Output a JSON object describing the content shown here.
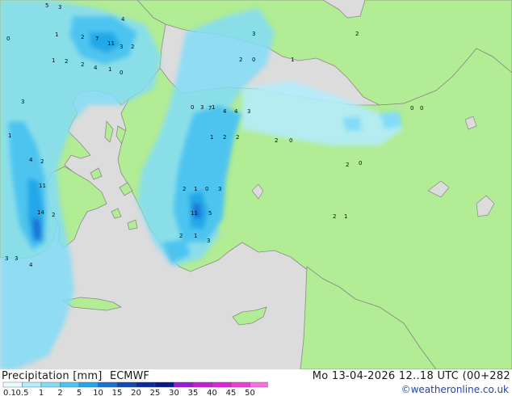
{
  "footer": {
    "title": "Precipitation [mm]",
    "model": "ECMWF",
    "datetime": "Mo 13-04-2026 12..18 UTC (00+282",
    "credit": "©weatheronline.co.uk"
  },
  "legend": {
    "labels": [
      "0.1",
      "0.5",
      "1",
      "2",
      "5",
      "10",
      "15",
      "20",
      "25",
      "30",
      "35",
      "40",
      "45",
      "50"
    ],
    "colors": [
      "#e8fbff",
      "#b4ecfc",
      "#82dcf7",
      "#4ec4f0",
      "#22a8e8",
      "#1a72d6",
      "#1247b8",
      "#0a2aa0",
      "#06188a",
      "#9b19d8",
      "#c41ed8",
      "#e222d8",
      "#f03ad2",
      "#f86ee0"
    ]
  },
  "map_colors": {
    "sea": "#dcdcdc",
    "land": "#b2ec94",
    "border": "#8a8a8a"
  },
  "station_values": [
    {
      "text": "5",
      "region": "w-greece"
    },
    {
      "text": "3",
      "region": "w-greece"
    },
    {
      "text": "4",
      "region": "w-greece"
    },
    {
      "text": "0",
      "region": "w-greece"
    },
    {
      "text": "1",
      "region": "w-greece"
    },
    {
      "text": "2",
      "region": "w-greece"
    },
    {
      "text": "7",
      "region": "w-greece"
    },
    {
      "text": "11",
      "region": "w-greece"
    },
    {
      "text": "3",
      "region": "w-greece"
    },
    {
      "text": "2",
      "region": "w-greece"
    },
    {
      "text": "1",
      "region": "w-greece"
    },
    {
      "text": "2",
      "region": "w-greece"
    },
    {
      "text": "2",
      "region": "w-greece"
    },
    {
      "text": "4",
      "region": "w-greece"
    },
    {
      "text": "1",
      "region": "w-greece"
    },
    {
      "text": "0",
      "region": "w-greece"
    },
    {
      "text": "3",
      "region": "w-greece"
    },
    {
      "text": "1",
      "region": "w-greece"
    },
    {
      "text": "11",
      "region": "w-greece"
    },
    {
      "text": "14",
      "region": "w-greece"
    },
    {
      "text": "2",
      "region": "w-greece"
    },
    {
      "text": "4",
      "region": "w-greece"
    },
    {
      "text": "2",
      "region": "w-greece"
    },
    {
      "text": "3",
      "region": "w-greece"
    },
    {
      "text": "3",
      "region": "w-greece"
    },
    {
      "text": "4",
      "region": "w-greece"
    },
    {
      "text": "2",
      "region": "turkey"
    },
    {
      "text": "3",
      "region": "turkey"
    },
    {
      "text": "2",
      "region": "turkey"
    },
    {
      "text": "0",
      "region": "turkey"
    },
    {
      "text": "1",
      "region": "turkey"
    },
    {
      "text": "0",
      "region": "turkey"
    },
    {
      "text": "3",
      "region": "turkey"
    },
    {
      "text": "1",
      "region": "turkey"
    },
    {
      "text": "4",
      "region": "turkey"
    },
    {
      "text": "1",
      "region": "turkey"
    },
    {
      "text": "2",
      "region": "turkey"
    },
    {
      "text": "2",
      "region": "turkey"
    },
    {
      "text": "7",
      "region": "turkey"
    },
    {
      "text": "4",
      "region": "turkey"
    },
    {
      "text": "3",
      "region": "turkey"
    },
    {
      "text": "2",
      "region": "turkey"
    },
    {
      "text": "1",
      "region": "turkey"
    },
    {
      "text": "0",
      "region": "turkey"
    },
    {
      "text": "3",
      "region": "turkey"
    },
    {
      "text": "11",
      "region": "turkey"
    },
    {
      "text": "5",
      "region": "turkey"
    },
    {
      "text": "2",
      "region": "turkey"
    },
    {
      "text": "1",
      "region": "turkey"
    },
    {
      "text": "3",
      "region": "turkey"
    },
    {
      "text": "2",
      "region": "turkey"
    },
    {
      "text": "1",
      "region": "turkey"
    },
    {
      "text": "2",
      "region": "turkey"
    },
    {
      "text": "0",
      "region": "turkey"
    },
    {
      "text": "0",
      "region": "turkey"
    },
    {
      "text": "2",
      "region": "turkey"
    },
    {
      "text": "0",
      "region": "east"
    },
    {
      "text": "0",
      "region": "east"
    }
  ]
}
